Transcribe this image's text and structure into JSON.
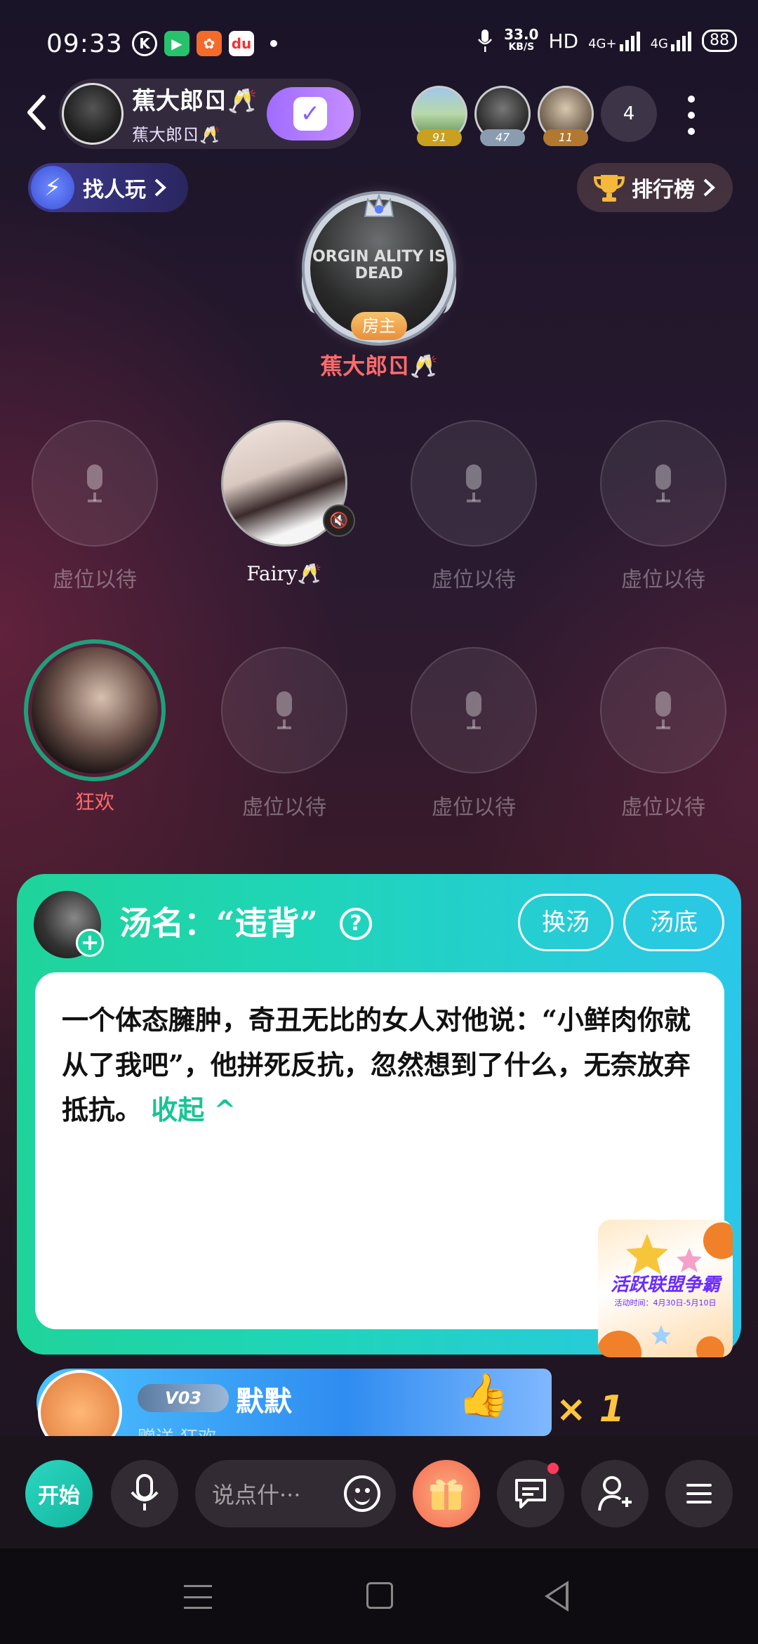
{
  "status_bar": {
    "time": "09:33",
    "app_icons": [
      "K",
      "▶",
      "✿",
      "du"
    ],
    "net_speed_value": "33.0",
    "net_speed_unit": "KB/S",
    "hd": "HD",
    "signal_1": "4G+",
    "signal_2": "4G",
    "battery": "88"
  },
  "header": {
    "room_name": "蕉大郎ㄖ🥂",
    "room_sub": "蕉大郎ㄖ🥂",
    "audience": [
      {
        "badge": "91",
        "badge_color": "#c9a020"
      },
      {
        "badge": "47",
        "badge_color": "#8a9cb0"
      },
      {
        "badge": "11",
        "badge_color": "#b07830"
      }
    ],
    "audience_count": "4"
  },
  "actions": {
    "find_label": "找人玩",
    "rank_label": "排行榜"
  },
  "host": {
    "photo_text": "ORGIN ALITY IS DEAD",
    "badge": "房主",
    "name": "蕉大郎ㄖ🥂"
  },
  "seats": [
    {
      "label": "虚位以待"
    },
    {
      "name": "Fairy🥂"
    },
    {
      "label": "虚位以待"
    },
    {
      "label": "虚位以待"
    },
    {
      "name": "狂欢"
    },
    {
      "label": "虚位以待"
    },
    {
      "label": "虚位以待"
    },
    {
      "label": "虚位以待"
    }
  ],
  "soup_card": {
    "title": "汤名：“违背”",
    "help": "?",
    "change_btn": "换汤",
    "answer_btn": "汤底",
    "body": "一个体态臃肿，奇丑无比的女人对他说：“小鲜肉你就从了我吧”，他拼死反抗，忽然想到了什么，无奈放弃抵抗。",
    "collapse": "收起 ^"
  },
  "promo": {
    "title": "活跃联盟争霸",
    "sub": "活动时间：4月30日-5月10日"
  },
  "gift_banner": {
    "vip": "V03",
    "user": "默默",
    "sub": "赠送 狂欢",
    "count": "× 1"
  },
  "toolbar": {
    "start": "开始",
    "chat_placeholder": "说点什···"
  }
}
